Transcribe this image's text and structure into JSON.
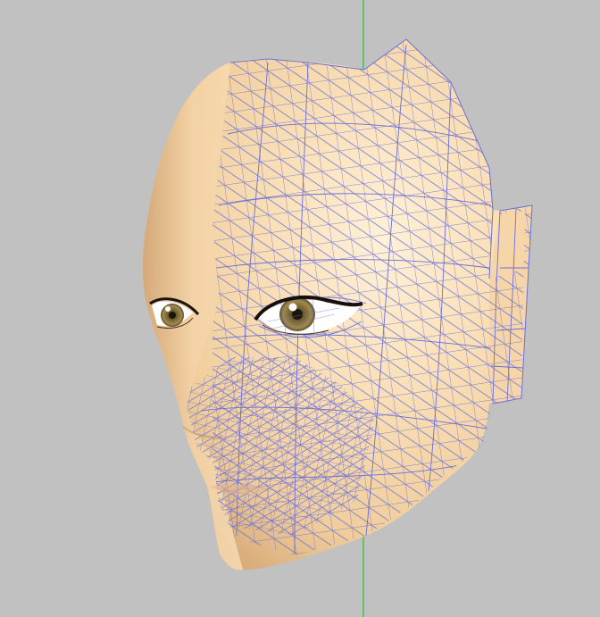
{
  "viewport": {
    "background": "#c1c1c1",
    "axis_color": "#19c819",
    "skin_base": "#f2d3a6",
    "skin_highlight": "#fde7c4",
    "skin_shadow": "#d9b081",
    "wire_color": "#6a6fd8",
    "iris_color": "#8a7442",
    "objects": [
      "3d-head-mesh",
      "vertical-axis-line"
    ]
  }
}
